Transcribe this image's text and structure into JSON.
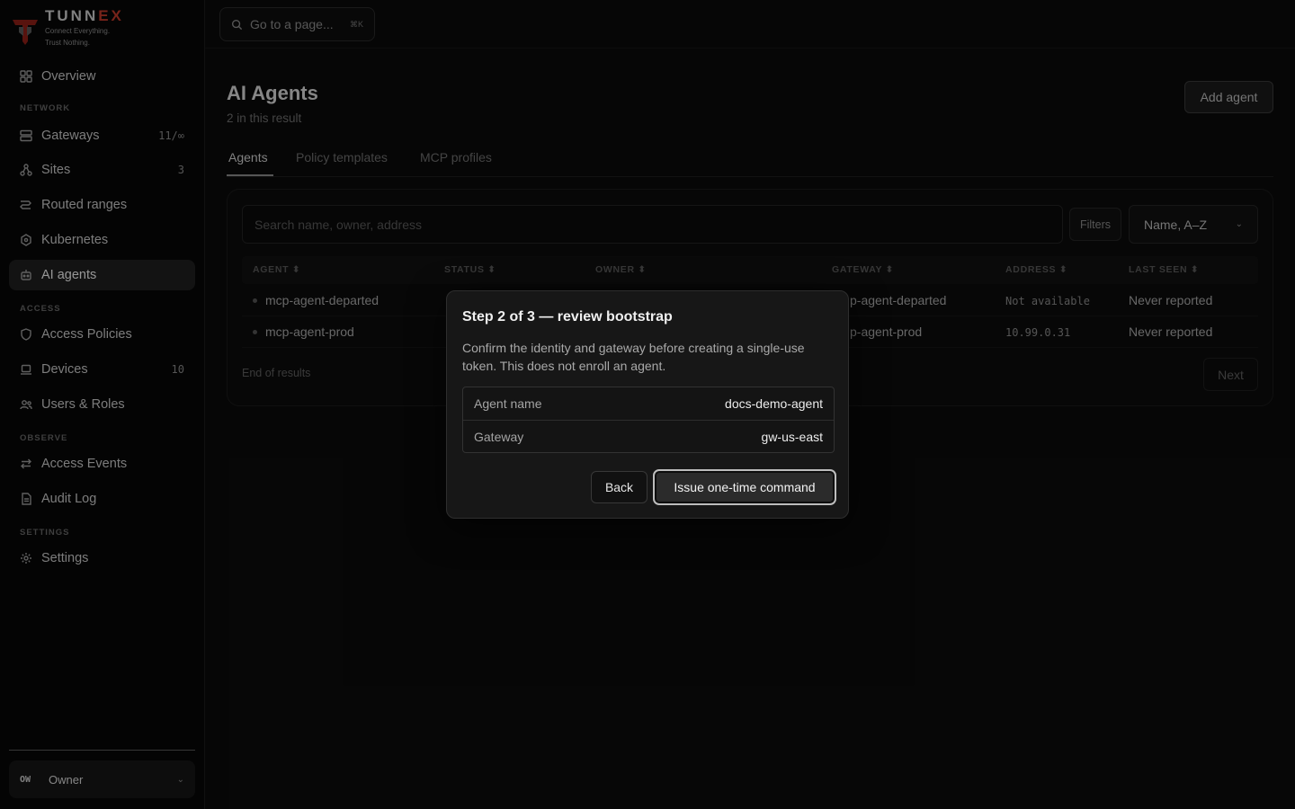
{
  "brand": {
    "name_prefix": "TUNN",
    "name_accent": "EX",
    "tagline_1": "Connect Everything.",
    "tagline_2": "Trust Nothing."
  },
  "sidebar": {
    "overview": "Overview",
    "sections": {
      "network": "NETWORK",
      "access": "ACCESS",
      "observe": "OBSERVE",
      "settings": "SETTINGS"
    },
    "items": {
      "gateways": {
        "label": "Gateways",
        "count": "11/∞"
      },
      "sites": {
        "label": "Sites",
        "count": "3"
      },
      "routed_ranges": {
        "label": "Routed ranges"
      },
      "kubernetes": {
        "label": "Kubernetes"
      },
      "ai_agents": {
        "label": "AI agents"
      },
      "access_policies": {
        "label": "Access Policies"
      },
      "devices": {
        "label": "Devices",
        "count": "10"
      },
      "users_roles": {
        "label": "Users & Roles"
      },
      "access_events": {
        "label": "Access Events"
      },
      "audit_log": {
        "label": "Audit Log"
      },
      "settings": {
        "label": "Settings"
      }
    },
    "user": {
      "initials": "OW",
      "role": "Owner"
    }
  },
  "topbar": {
    "goto_placeholder": "Go to a page...",
    "goto_shortcut": "⌘K"
  },
  "page": {
    "title": "AI Agents",
    "subtitle": "2 in this result",
    "add_button": "Add agent",
    "tabs": [
      "Agents",
      "Policy templates",
      "MCP profiles"
    ],
    "active_tab": "Agents"
  },
  "table": {
    "search_placeholder": "Search name, owner, address",
    "filters_label": "Filters",
    "sort_value": "Name, A–Z",
    "columns": [
      "AGENT ⬍",
      "STATUS ⬍",
      "OWNER ⬍",
      "GATEWAY ⬍",
      "ADDRESS ⬍",
      "LAST SEEN ⬍"
    ],
    "rows": [
      {
        "agent": "mcp-agent-departed",
        "gateway": "p-agent-departed",
        "address": "Not available",
        "last_seen": "Never reported"
      },
      {
        "agent": "mcp-agent-prod",
        "gateway": "p-agent-prod",
        "address": "10.99.0.31",
        "last_seen": "Never reported"
      }
    ],
    "end_text": "End of results",
    "next_label": "Next"
  },
  "modal": {
    "title": "Step 2 of 3 — review bootstrap",
    "description": "Confirm the identity and gateway before creating a single-use token. This does not enroll an agent.",
    "fields": [
      {
        "key": "Agent name",
        "value": "docs-demo-agent"
      },
      {
        "key": "Gateway",
        "value": "gw-us-east"
      }
    ],
    "back_label": "Back",
    "issue_label": "Issue one-time command"
  }
}
